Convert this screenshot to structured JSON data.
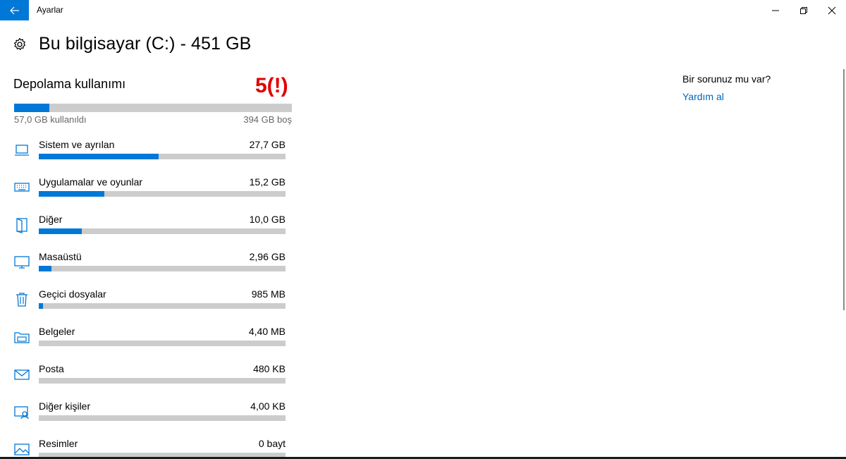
{
  "window": {
    "title": "Ayarlar"
  },
  "header": {
    "title": "Bu bilgisayar (C:) - 451 GB"
  },
  "storage": {
    "section_title": "Depolama kullanımı",
    "marker": "5(!)",
    "used_label": "57,0 GB kullanıldı",
    "free_label": "394 GB boş",
    "used_fraction": 0.126
  },
  "categories": [
    {
      "name": "Sistem ve ayrılan",
      "size": "27,7 GB",
      "fraction": 0.486,
      "icon": "laptop-icon"
    },
    {
      "name": "Uygulamalar ve oyunlar",
      "size": "15,2 GB",
      "fraction": 0.267,
      "icon": "keyboard-icon"
    },
    {
      "name": "Diğer",
      "size": "10,0 GB",
      "fraction": 0.175,
      "icon": "folder-door-icon"
    },
    {
      "name": "Masaüstü",
      "size": "2,96 GB",
      "fraction": 0.052,
      "icon": "monitor-icon"
    },
    {
      "name": "Geçici dosyalar",
      "size": "985 MB",
      "fraction": 0.017,
      "icon": "trash-icon"
    },
    {
      "name": "Belgeler",
      "size": "4,40 MB",
      "fraction": 0,
      "icon": "documents-icon"
    },
    {
      "name": "Posta",
      "size": "480 KB",
      "fraction": 0,
      "icon": "mail-icon"
    },
    {
      "name": "Diğer kişiler",
      "size": "4,00 KB",
      "fraction": 0,
      "icon": "other-people-icon"
    },
    {
      "name": "Resimler",
      "size": "0 bayt",
      "fraction": 0,
      "icon": "pictures-icon"
    }
  ],
  "help": {
    "question": "Bir sorunuz mu var?",
    "link": "Yardım al"
  },
  "colors": {
    "accent": "#0078d7",
    "bar_bg": "#cccccc",
    "marker": "#e00000",
    "link": "#0067b8"
  }
}
